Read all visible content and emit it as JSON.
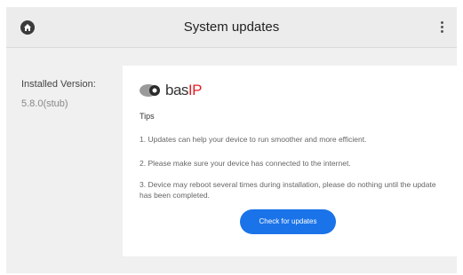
{
  "header": {
    "title": "System updates"
  },
  "sidebar": {
    "installed_label": "Installed Version:",
    "installed_value": "5.8.0(stub)"
  },
  "card": {
    "logo": {
      "bas": "bas",
      "ip": "IP"
    },
    "tips_title": "Tips",
    "tips": [
      "1. Updates can help your device to run smoother and more efficient.",
      "2. Please make sure your device has connected to the internet.",
      "3. Device may reboot several times during installation, please do nothing until the update has been completed."
    ],
    "check_button": "Check for updates"
  },
  "colors": {
    "accent": "#1a73e8",
    "logo_red": "#e31e24"
  }
}
